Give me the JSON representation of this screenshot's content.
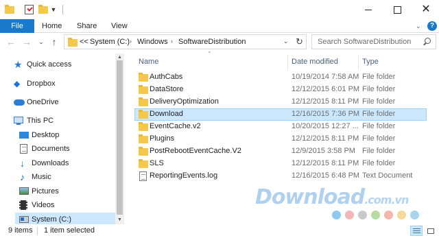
{
  "title_bar": {
    "qa_toolbar_items": [
      "folder-icon",
      "properties-icon",
      "new-folder-icon",
      "customize-caret"
    ],
    "window_controls": [
      "minimize",
      "maximize",
      "close"
    ]
  },
  "ribbon": {
    "file_label": "File",
    "tabs": [
      "Home",
      "Share",
      "View"
    ],
    "accent_color": "#1979ca"
  },
  "address": {
    "crumbs": [
      "System (C:)",
      "Windows",
      "SoftwareDistribution"
    ],
    "overflow": "<<"
  },
  "search": {
    "placeholder": "Search SoftwareDistribution"
  },
  "sidebar": {
    "items": [
      {
        "label": "Quick access",
        "icon": "star-icon"
      },
      {
        "label": "Dropbox",
        "icon": "dropbox-icon"
      },
      {
        "label": "OneDrive",
        "icon": "cloud-icon"
      },
      {
        "label": "This PC",
        "icon": "pc-icon"
      },
      {
        "label": "Desktop",
        "icon": "desktop-icon"
      },
      {
        "label": "Documents",
        "icon": "documents-icon"
      },
      {
        "label": "Downloads",
        "icon": "downloads-icon"
      },
      {
        "label": "Music",
        "icon": "music-icon"
      },
      {
        "label": "Pictures",
        "icon": "pictures-icon"
      },
      {
        "label": "Videos",
        "icon": "videos-icon"
      },
      {
        "label": "System (C:)",
        "icon": "drive-icon",
        "selected": true
      }
    ]
  },
  "file_list": {
    "columns": [
      "Name",
      "Date modified",
      "Type"
    ],
    "rows": [
      {
        "name": "AuthCabs",
        "date": "10/19/2014 7:58 AM",
        "type": "File folder",
        "kind": "folder"
      },
      {
        "name": "DataStore",
        "date": "12/12/2015 6:01 PM",
        "type": "File folder",
        "kind": "folder"
      },
      {
        "name": "DeliveryOptimization",
        "date": "12/12/2015 8:11 PM",
        "type": "File folder",
        "kind": "folder"
      },
      {
        "name": "Download",
        "date": "12/16/2015 7:36 PM",
        "type": "File folder",
        "kind": "folder",
        "selected": true
      },
      {
        "name": "EventCache.v2",
        "date": "10/20/2015 12:27 ...",
        "type": "File folder",
        "kind": "folder"
      },
      {
        "name": "Plugins",
        "date": "12/12/2015 8:11 PM",
        "type": "File folder",
        "kind": "folder"
      },
      {
        "name": "PostRebootEventCache.V2",
        "date": "12/9/2015 3:58 PM",
        "type": "File folder",
        "kind": "folder"
      },
      {
        "name": "SLS",
        "date": "12/12/2015 8:11 PM",
        "type": "File folder",
        "kind": "folder"
      },
      {
        "name": "ReportingEvents.log",
        "date": "12/16/2015 6:48 PM",
        "type": "Text Document",
        "kind": "text"
      }
    ]
  },
  "status_bar": {
    "item_count": "9 items",
    "selection": "1 item selected"
  },
  "watermark": {
    "brand": "Download",
    "tld": ".com.vn",
    "dot_colors": [
      "#8ec9ef",
      "#f3b6b6",
      "#c9c9c9",
      "#b7dba0",
      "#f4b7a9",
      "#f3d99a",
      "#a9d4ef"
    ]
  }
}
